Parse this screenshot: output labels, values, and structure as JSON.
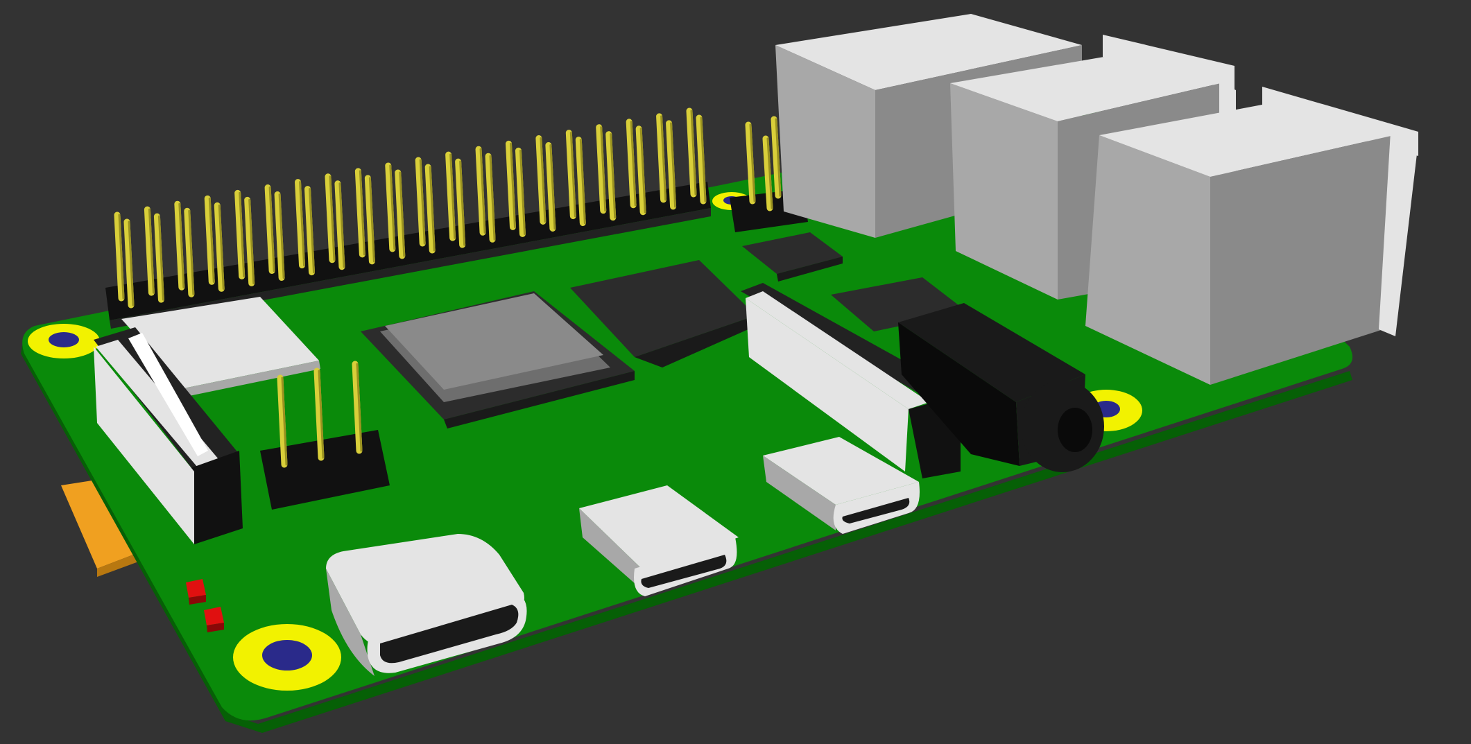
{
  "scene": {
    "subject": "",
    "colors": {
      "background": "#333333",
      "pcb": "#0a8a0a",
      "pcb_edge": "#066006",
      "pad": "#f2f200",
      "hole": "#2a2a8a",
      "chip": "#2a2a2a",
      "metal": "#bdbdbd",
      "metal_light": "#e6e6e6",
      "pin": "#d9cf3a",
      "header": "#111111",
      "jack": "#1a1a1a",
      "sd_card": "#f0a020",
      "led": "#dd1111"
    },
    "components": [
      "gpio-header-40pin",
      "poe-header-4pin",
      "ethernet-jack",
      "usb-port-upper",
      "usb-port-lower",
      "soc-chip",
      "ram-chip",
      "usb-controller-chip",
      "wifi-module",
      "camera-connector",
      "display-connector",
      "audio-jack",
      "micro-hdmi-port-0",
      "micro-hdmi-port-1",
      "usb-c-power-port",
      "run-header-3pin",
      "micro-sd-card",
      "status-leds",
      "mounting-holes"
    ]
  }
}
